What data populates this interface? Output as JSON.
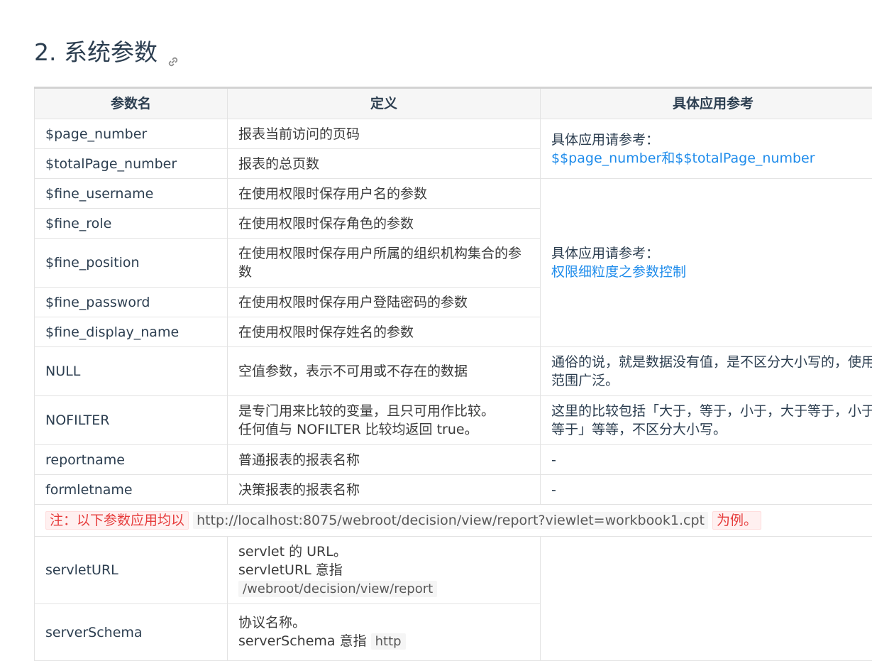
{
  "heading": {
    "title": "2. 系统参数",
    "anchor_icon": "link-icon"
  },
  "table": {
    "headers": [
      "参数名",
      "定义",
      "具体应用参考"
    ],
    "rows": [
      {
        "name": "$page_number",
        "def": "报表当前访问的页码"
      },
      {
        "name": "$totalPage_number",
        "def": "报表的总页数"
      },
      {
        "name": "$fine_username",
        "def": "在使用权限时保存用户名的参数"
      },
      {
        "name": "$fine_role",
        "def": "在使用权限时保存角色的参数"
      },
      {
        "name": "$fine_position",
        "def": "在使用权限时保存用户所属的组织机构集合的参数"
      },
      {
        "name": "$fine_password",
        "def": "在使用权限时保存用户登陆密码的参数"
      },
      {
        "name": "$fine_display_name",
        "def": "在使用权限时保存姓名的参数"
      },
      {
        "name": "NULL",
        "def": "空值参数，表示不可用或不存在的数据",
        "ref": "通俗的说，就是数据没有值，是不区分大小写的，使用范围广泛。"
      },
      {
        "name": "NOFILTER",
        "def_line1": "是专门用来比较的变量，且只可用作比较。",
        "def_line2": "任何值与 NOFILTER 比较均返回 true。",
        "ref": "这里的比较包括「大于，等于，小于，大于等于，小于等于」等等，不区分大小写。"
      },
      {
        "name": "reportname",
        "def": "普通报表的报表名称",
        "ref": "-"
      },
      {
        "name": "formletname",
        "def": "决策报表的报表名称",
        "ref": "-"
      }
    ],
    "ref_group1": {
      "prefix": "具体应用请参考：",
      "link": "$$page_number和$$totalPage_number"
    },
    "ref_group2": {
      "prefix": "具体应用请参考：",
      "link": "权限细粒度之参数控制"
    },
    "note": {
      "prefix": "注：以下参数应用均以",
      "url": "http://localhost:8075/webroot/decision/view/report?viewlet=workbook1.cpt",
      "suffix": "为例。"
    },
    "rows2": [
      {
        "name": "servletURL",
        "def_line1": "servlet 的 URL。",
        "def_line2": "servletURL 意指",
        "def_code": "/webroot/decision/view/report"
      },
      {
        "name": "serverSchema",
        "def_line1": "协议名称。",
        "def_line2": "serverSchema 意指",
        "def_code": "http"
      }
    ]
  },
  "colors": {
    "link": "#1f8ceb",
    "note_red": "#e63b3b",
    "header_bg": "#f6f6f6",
    "border": "#e3e3e3"
  }
}
